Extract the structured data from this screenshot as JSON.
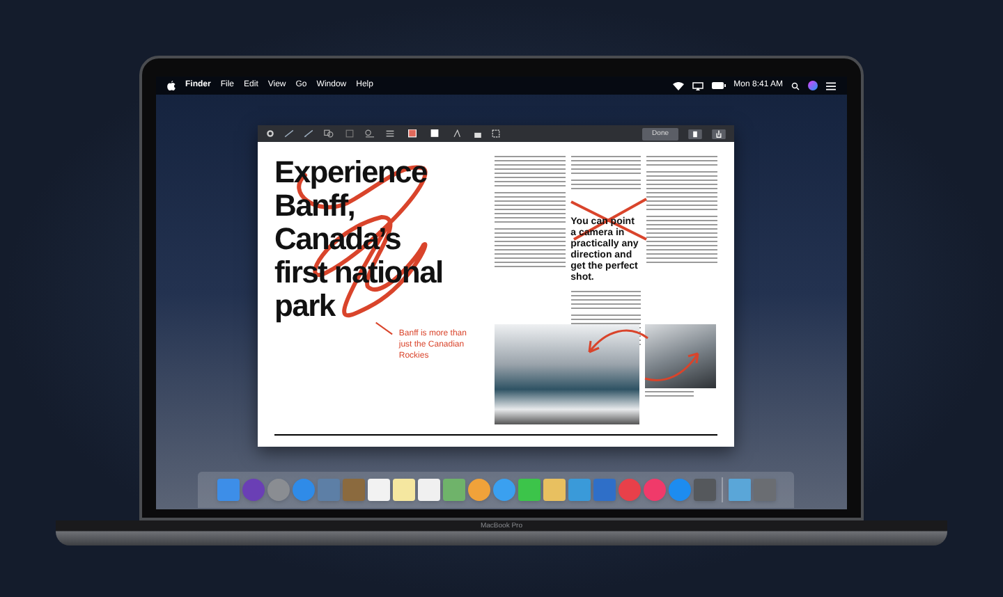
{
  "menu_bar": {
    "menus": [
      "Finder",
      "File",
      "Edit",
      "View",
      "Go",
      "Window",
      "Help"
    ],
    "clock": "Mon 8:41 AM"
  },
  "document_window": {
    "toolbar": {
      "done_button": "Done"
    },
    "page": {
      "headline": [
        "Experience",
        "Banff,",
        "Canada’s",
        "first national",
        "park"
      ],
      "annotation": "Banff is more than just the Canadian Rockies",
      "pull_quote": "You can point a camera in practically any direction and get the perfect shot."
    }
  },
  "device_label": "MacBook Pro"
}
